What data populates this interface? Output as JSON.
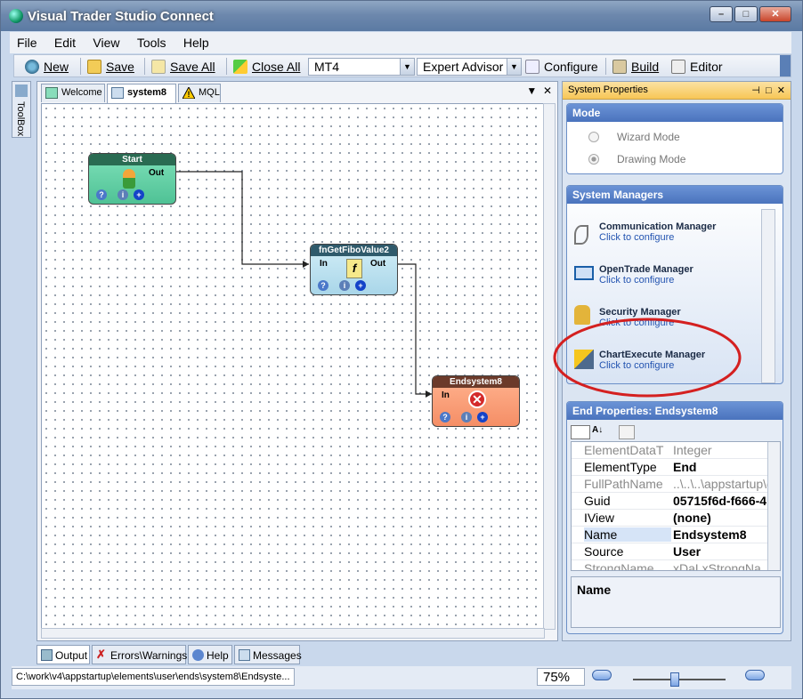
{
  "window": {
    "title": "Visual Trader Studio Connect"
  },
  "menu": [
    "File",
    "Edit",
    "View",
    "Tools",
    "Help"
  ],
  "toolbar": {
    "new": "New",
    "save": "Save",
    "save_all": "Save All",
    "close_all": "Close All",
    "platform": "MT4",
    "mode_combo": "Expert Advisor",
    "configure": "Configure",
    "build": "Build",
    "editor": "Editor"
  },
  "toolbox": {
    "label": "ToolBox"
  },
  "doc_tabs": [
    {
      "label": "Welcome"
    },
    {
      "label": "system8"
    },
    {
      "label": "MQL"
    }
  ],
  "nodes": {
    "start": {
      "title": "Start",
      "out": "Out"
    },
    "fn": {
      "title": "fnGetFiboValue2",
      "in": "In",
      "out": "Out"
    },
    "end": {
      "title": "Endsystem8",
      "in": "In"
    }
  },
  "right_pane": {
    "title": "System Properties"
  },
  "mode_group": {
    "title": "Mode",
    "wizard": "Wizard Mode",
    "drawing": "Drawing Mode"
  },
  "managers_group": {
    "title": "System Managers",
    "items": [
      {
        "name": "Communication Manager",
        "sub": "Click to configure"
      },
      {
        "name": "OpenTrade Manager",
        "sub": "Click to configure"
      },
      {
        "name": "Security Manager",
        "sub": "Click to configure"
      },
      {
        "name": "ChartExecute Manager",
        "sub": "Click to configure"
      }
    ]
  },
  "end_props": {
    "title": "End Properties: Endsystem8",
    "rows": [
      {
        "k": "ElementDataT",
        "v": "Integer"
      },
      {
        "k": "ElementType",
        "v": "End"
      },
      {
        "k": "FullPathName",
        "v": "..\\..\\..\\appstartup\\e"
      },
      {
        "k": "Guid",
        "v": "05715f6d-f666-4"
      },
      {
        "k": "IView",
        "v": "(none)"
      },
      {
        "k": "Name",
        "v": "Endsystem8"
      },
      {
        "k": "Source",
        "v": "User"
      },
      {
        "k": "StrongName",
        "v": "xDaLxStrongNa"
      }
    ],
    "desc_title": "Name"
  },
  "bottom_tabs": [
    "Output",
    "Errors\\Warnings",
    "Help",
    "Messages"
  ],
  "status": {
    "path": "C:\\work\\v4\\appstartup\\elements\\user\\ends\\system8\\Endsyste...",
    "zoom": "75%"
  }
}
